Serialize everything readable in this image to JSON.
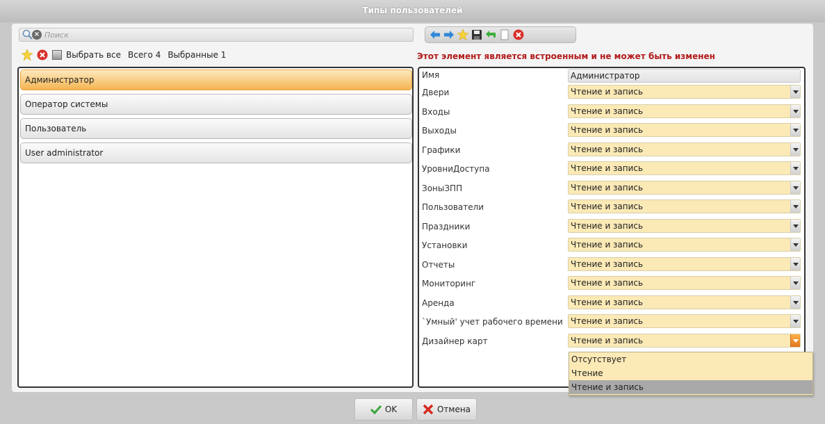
{
  "window": {
    "title": "Типы пользователей"
  },
  "search": {
    "placeholder": "Поиск"
  },
  "left_toolbar": {
    "select_all_label": "Выбрать все",
    "total_label": "Всего 4",
    "selected_label": "Выбранные 1"
  },
  "user_types": [
    {
      "label": "Администратор",
      "selected": true
    },
    {
      "label": "Оператор системы",
      "selected": false
    },
    {
      "label": "Пользователь",
      "selected": false
    },
    {
      "label": "User administrator",
      "selected": false
    }
  ],
  "warning": "Этот элемент является встроенным и не может быть изменен",
  "properties": {
    "name_label": "Имя",
    "name_value": "Администратор",
    "rows": [
      {
        "label": "Двери",
        "value": "Чтение и запись"
      },
      {
        "label": "Входы",
        "value": "Чтение и запись"
      },
      {
        "label": "Выходы",
        "value": "Чтение и запись"
      },
      {
        "label": "Графики",
        "value": "Чтение и запись"
      },
      {
        "label": "УровниДоступа",
        "value": "Чтение и запись"
      },
      {
        "label": "ЗоныЗПП",
        "value": "Чтение и запись"
      },
      {
        "label": "Пользователи",
        "value": "Чтение и запись"
      },
      {
        "label": "Праздники",
        "value": "Чтение и запись"
      },
      {
        "label": "Установки",
        "value": "Чтение и запись"
      },
      {
        "label": "Отчеты",
        "value": "Чтение и запись"
      },
      {
        "label": "Мониторинг",
        "value": "Чтение и запись"
      },
      {
        "label": "Аренда",
        "value": "Чтение и запись"
      },
      {
        "label": "`Умный' учет рабочего времени",
        "value": "Чтение и запись"
      },
      {
        "label": "Дизайнер карт",
        "value": "Чтение и запись"
      }
    ]
  },
  "dropdown": {
    "options": [
      "Отсутствует",
      "Чтение",
      "Чтение и запись"
    ],
    "selected_index": 2
  },
  "footer": {
    "ok_label": "OK",
    "cancel_label": "Отмена"
  },
  "colors": {
    "selected_item": "#f5b450",
    "warning": "#b21b1b",
    "permission_field": "#fbe9b6"
  }
}
